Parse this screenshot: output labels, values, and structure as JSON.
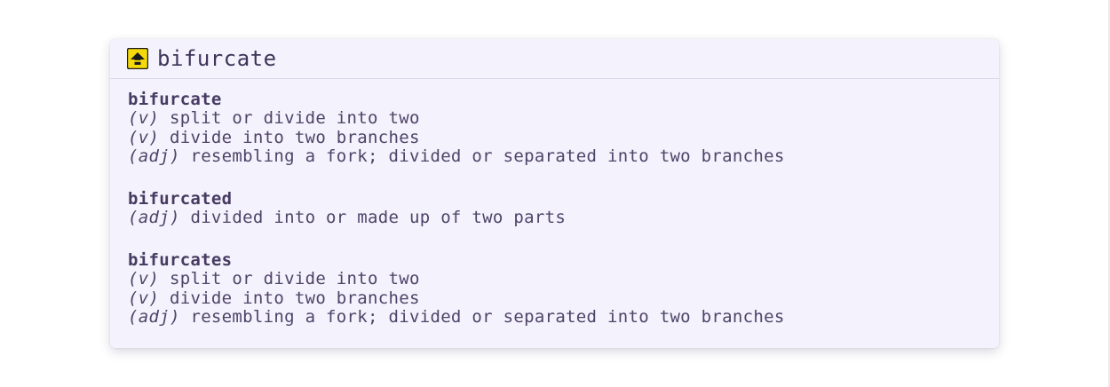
{
  "popup": {
    "title": "bifurcate",
    "icon": "arrow-up-icon",
    "accent_color": "#f5d90a"
  },
  "entries": [
    {
      "word": "bifurcate",
      "senses": [
        {
          "pos": "(v)",
          "text": "split or divide into two"
        },
        {
          "pos": "(v)",
          "text": "divide into two branches"
        },
        {
          "pos": "(adj)",
          "text": "resembling a fork; divided or separated into two branches"
        }
      ]
    },
    {
      "word": "bifurcated",
      "senses": [
        {
          "pos": "(adj)",
          "text": "divided into or made up of two parts"
        }
      ]
    },
    {
      "word": "bifurcates",
      "senses": [
        {
          "pos": "(v)",
          "text": "split or divide into two"
        },
        {
          "pos": "(v)",
          "text": "divide into two branches"
        },
        {
          "pos": "(adj)",
          "text": "resembling a fork; divided or separated into two branches"
        }
      ]
    }
  ]
}
